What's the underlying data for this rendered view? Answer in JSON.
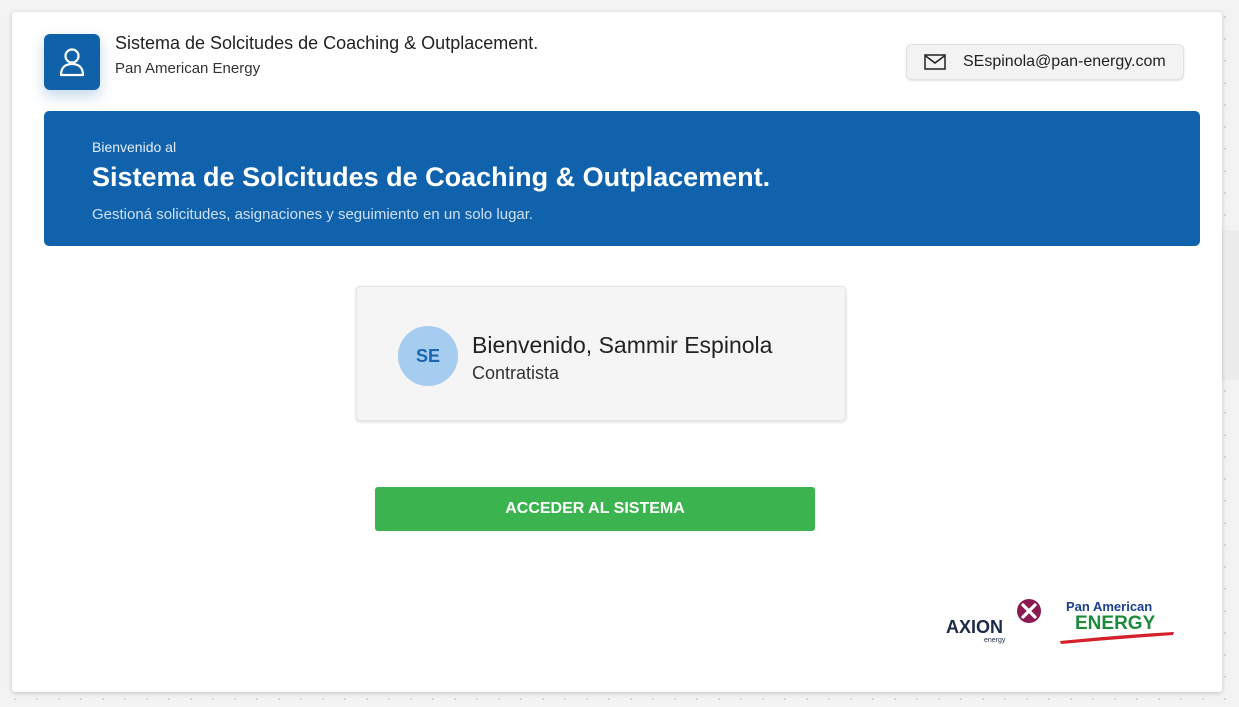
{
  "header": {
    "title": "Sistema de Solcitudes de Coaching & Outplacement.",
    "subtitle": "Pan American Energy",
    "app_icon": "user-icon",
    "user_email": "SEspinola@pan-energy.com",
    "email_icon": "mail-icon"
  },
  "banner": {
    "pre_title": "Bienvenido al",
    "title": "Sistema de Solcitudes de Coaching & Outplacement.",
    "subtitle": "Gestioná solicitudes, asignaciones y seguimiento en un solo lugar.",
    "background_color": "#1062ad"
  },
  "welcome_card": {
    "initials": "SE",
    "greeting": "Bienvenido, Sammir Espinola",
    "role": "Contratista"
  },
  "actions": {
    "access_label": "ACCEDER AL SISTEMA",
    "access_color": "#3bb34f"
  },
  "logos": {
    "axion": {
      "text": "AXION",
      "subtext": "energy"
    },
    "pan_american": {
      "line1": "Pan American",
      "line2": "ENERGY"
    }
  },
  "colors": {
    "primary": "#1062ad",
    "avatar_bg": "#a6cdf0",
    "success": "#3bb34f"
  }
}
